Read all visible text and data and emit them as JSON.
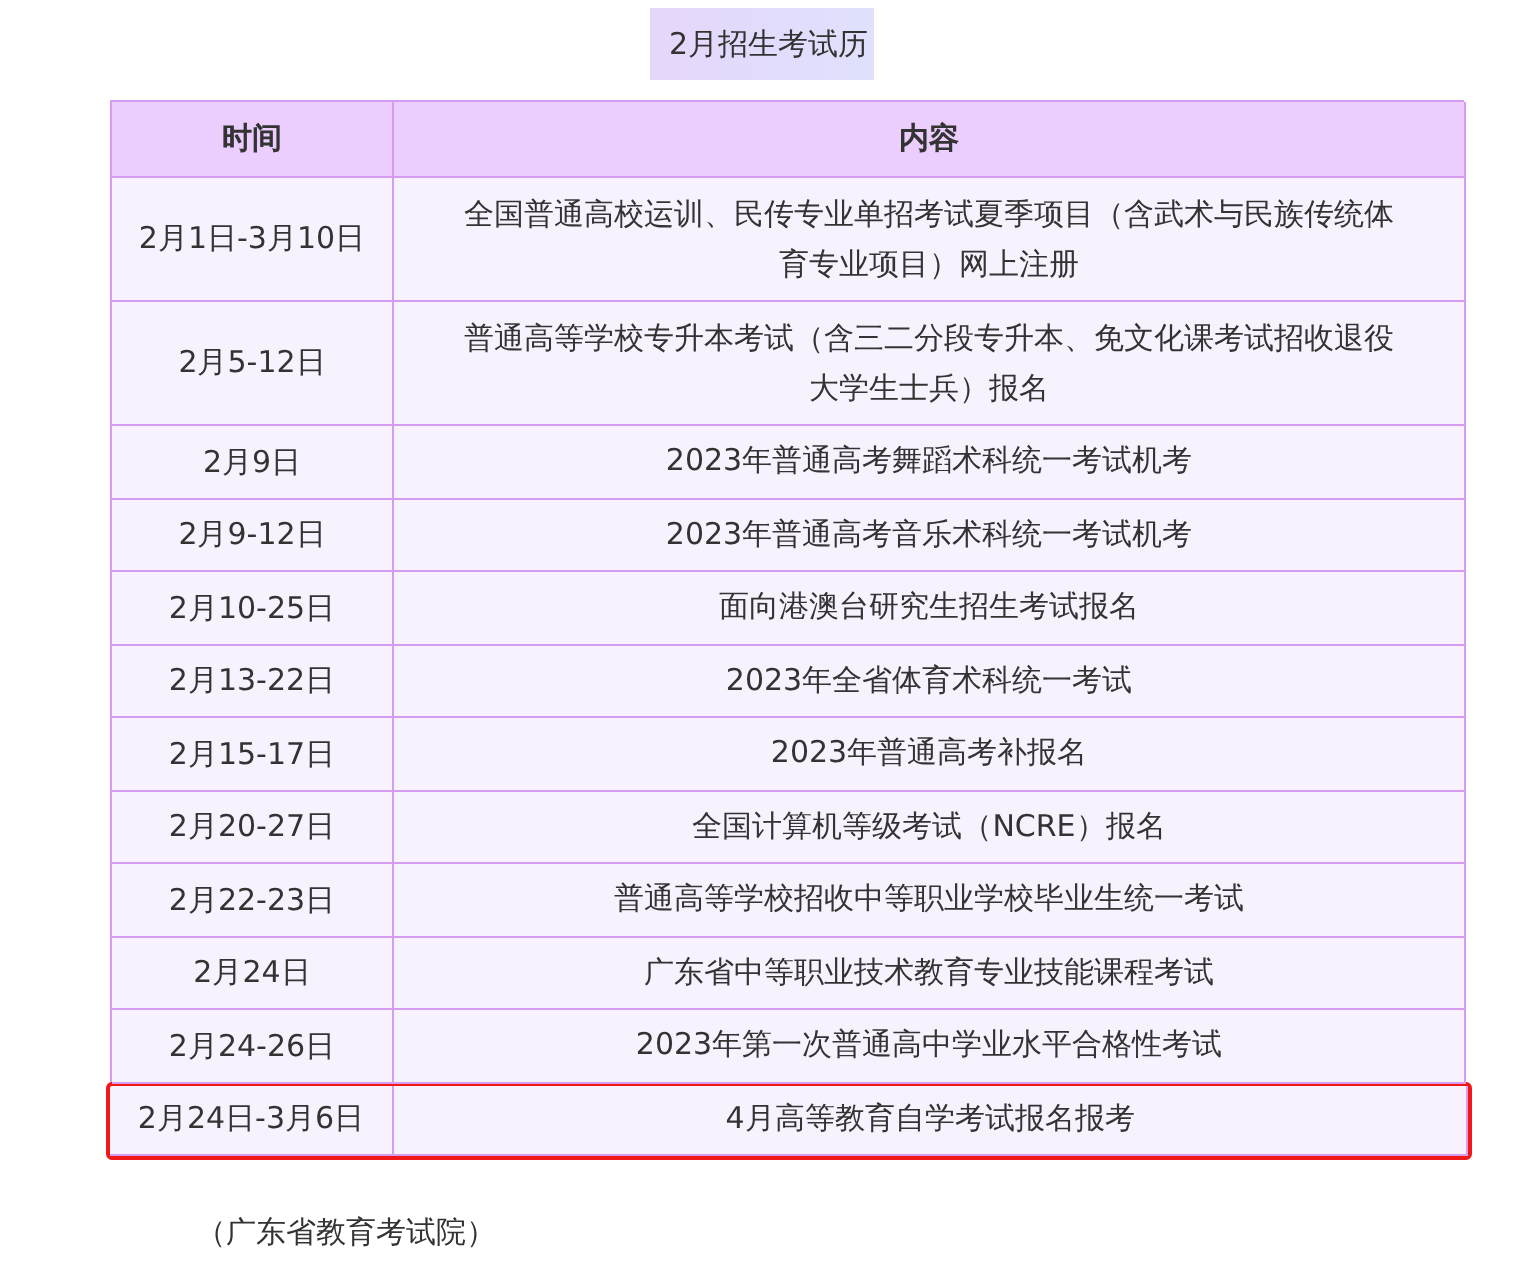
{
  "title": "2月招生考试历",
  "table": {
    "columns": [
      "时间",
      "内容"
    ],
    "rows": [
      {
        "time": "2月1日-3月10日",
        "content": "全国普通高校运训、民传专业单招考试夏季项目（含武术与民族传统体育专业项目）网上注册",
        "highlighted": false
      },
      {
        "time": "2月5-12日",
        "content": "普通高等学校专升本考试（含三二分段专升本、免文化课考试招收退役大学生士兵）报名",
        "highlighted": false
      },
      {
        "time": "2月9日",
        "content": "2023年普通高考舞蹈术科统一考试机考",
        "highlighted": false
      },
      {
        "time": "2月9-12日",
        "content": "2023年普通高考音乐术科统一考试机考",
        "highlighted": false
      },
      {
        "time": "2月10-25日",
        "content": "面向港澳台研究生招生考试报名",
        "highlighted": false
      },
      {
        "time": "2月13-22日",
        "content": "2023年全省体育术科统一考试",
        "highlighted": false
      },
      {
        "time": "2月15-17日",
        "content": "2023年普通高考补报名",
        "highlighted": false
      },
      {
        "time": "2月20-27日",
        "content": "全国计算机等级考试（NCRE）报名",
        "highlighted": false
      },
      {
        "time": "2月22-23日",
        "content": "普通高等学校招收中等职业学校毕业生统一考试",
        "highlighted": false
      },
      {
        "time": "2月24日",
        "content": "广东省中等职业技术教育专业技能课程考试",
        "highlighted": false
      },
      {
        "time": "2月24-26日",
        "content": "2023年第一次普通高中学业水平合格性考试",
        "highlighted": false
      },
      {
        "time": "2月24日-3月6日",
        "content": "4月高等教育自学考试报名报考",
        "highlighted": true
      }
    ]
  },
  "source": "（广东省教育考试院）"
}
